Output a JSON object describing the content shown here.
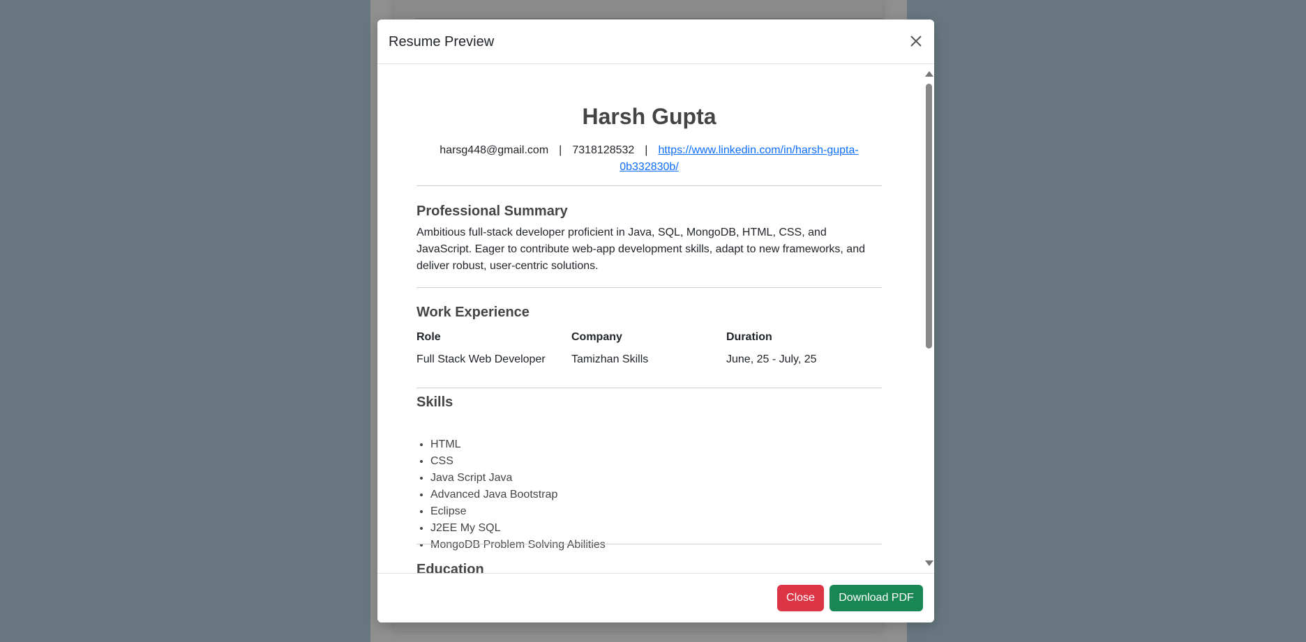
{
  "modal": {
    "title": "Resume Preview",
    "close_label": "Close",
    "download_label": "Download PDF"
  },
  "resume": {
    "name": "Harsh Gupta",
    "email": "harsg448@gmail.com",
    "separator": "|",
    "phone": "7318128532",
    "linkedin": "https://www.linkedin.com/in/harsh-gupta-0b332830b/",
    "sections": {
      "summary_title": "Professional Summary",
      "summary_text": "Ambitious full-stack developer proficient in Java, SQL, MongoDB, HTML, CSS, and JavaScript. Eager to contribute web-app development skills, adapt to new frameworks, and deliver robust, user-centric solutions.",
      "work_title": "Work Experience",
      "skills_title": "Skills",
      "education_title": "Education"
    },
    "work": {
      "headers": [
        "Role",
        "Company",
        "Duration"
      ],
      "rows": [
        [
          "Full Stack Web Developer",
          "Tamizhan Skills",
          "June, 25 - July, 25"
        ]
      ]
    },
    "skills": [
      "HTML",
      "CSS",
      "Java Script Java",
      "Advanced Java Bootstrap",
      "Eclipse",
      "J2EE My SQL",
      "MongoDB Problem Solving Abilities"
    ]
  },
  "colors": {
    "backdrop": "#67767f",
    "danger": "#dc3545",
    "success": "#198754",
    "link": "#0d6efd"
  },
  "icons": {
    "close": "close-icon",
    "scroll_up": "scroll-up-arrow-icon",
    "scroll_down": "scroll-down-arrow-icon"
  }
}
